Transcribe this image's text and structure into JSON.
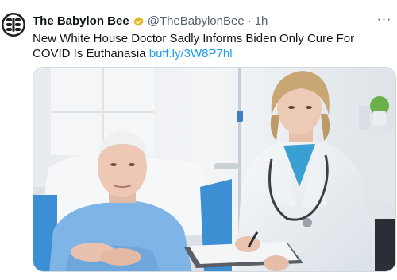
{
  "tweet": {
    "display_name": "The Babylon Bee",
    "handle": "@TheBabylonBee",
    "separator": "·",
    "time": "1h",
    "text": "New White House Doctor Sadly Informs Biden Only Cure For COVID Is Euthanasia",
    "link_text": "buff.ly/3W8P7hl",
    "more_label": "···"
  },
  "icons": {
    "avatar": "bee-logo-icon",
    "badge": "verified-gold-badge-icon",
    "more": "more-options-icon"
  },
  "colors": {
    "text": "#0f1419",
    "secondary": "#536471",
    "link": "#1d9bf0",
    "badge": "#e2b719"
  }
}
